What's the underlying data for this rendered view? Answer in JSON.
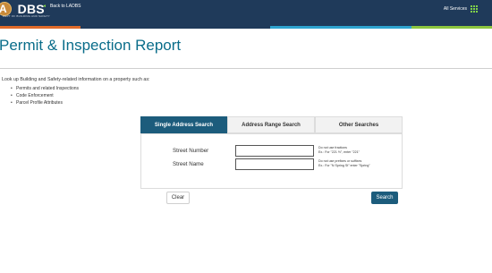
{
  "header": {
    "logo_text": "DBS",
    "logo_subtitle": "DEPT OF BUILDING AND SAFETY",
    "back_link": "Back to LADBS",
    "all_services": "All Services",
    "icons": {
      "back": "chevron-left-icon",
      "services": "grid-icon"
    },
    "color_stripes": [
      "#e06b2a",
      "#1f3a5a",
      "#2ea3cf",
      "#8cc63f"
    ]
  },
  "page": {
    "title": "Permit & Inspection Report",
    "intro": "Look up Building and Safety-related information on a property such as:",
    "bullets": [
      "Permits and related Inspections",
      "Code Enforcement",
      "Parcel Profile Attributes"
    ]
  },
  "tabs": [
    {
      "label": "Single Address Search",
      "active": true
    },
    {
      "label": "Address Range Search",
      "active": false
    },
    {
      "label": "Other Searches",
      "active": false
    }
  ],
  "form": {
    "street_number": {
      "label": "Street Number",
      "value": "",
      "hint_line1": "Do not use fractions",
      "hint_line2": "Ex.: For \"221 ½\", enter \"221\""
    },
    "street_name": {
      "label": "Street Name",
      "value": "",
      "hint_line1": "Do not use prefixes or suffixes",
      "hint_line2": "Ex.: For \"N Spring St\" enter \"Spring\""
    }
  },
  "actions": {
    "clear_label": "Clear",
    "search_label": "Search"
  },
  "colors": {
    "header_bg": "#1f3a5a",
    "accent": "#1c5c7c",
    "title": "#0a6d8a",
    "icon_green": "#7fd14a"
  }
}
